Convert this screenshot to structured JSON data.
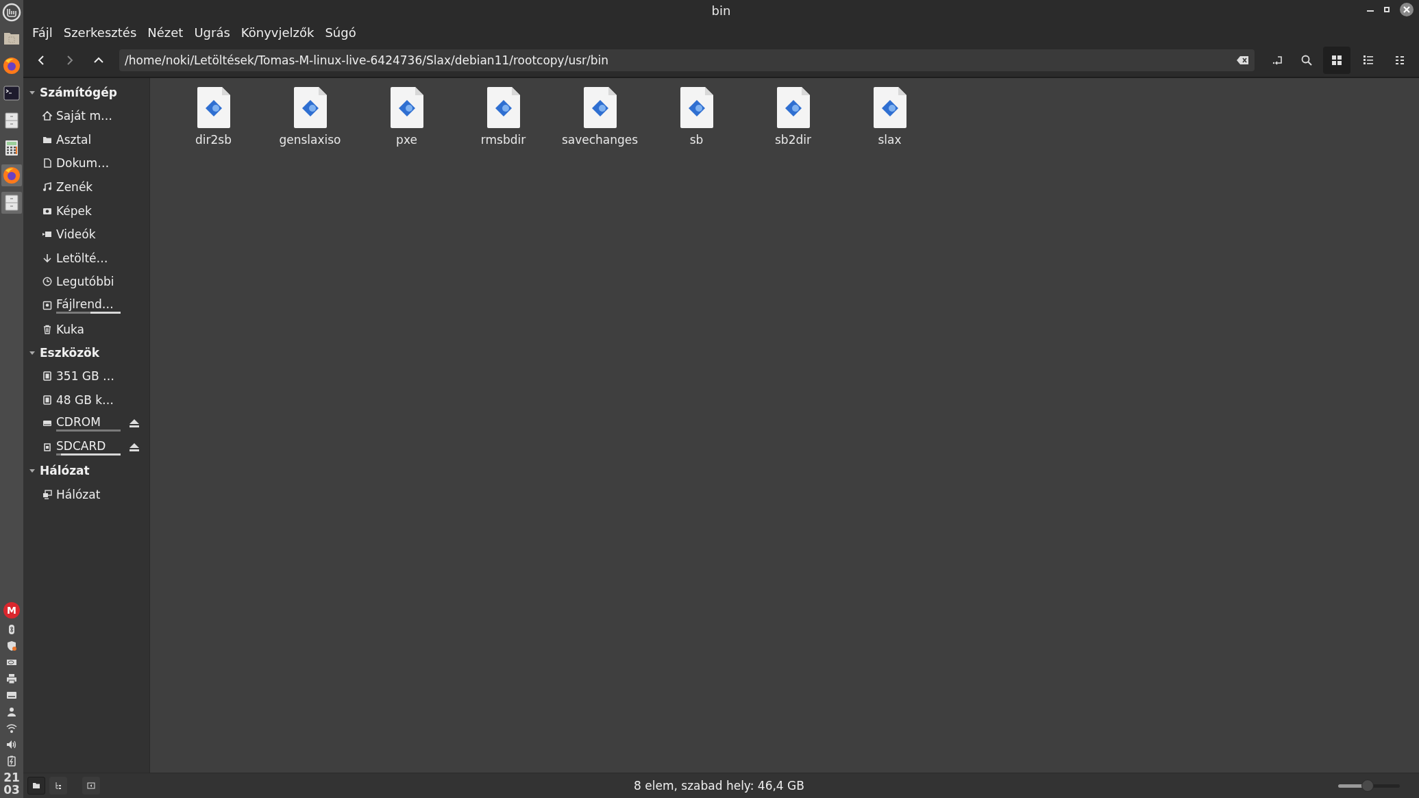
{
  "window": {
    "title": "bin"
  },
  "taskbar": {
    "apps": [
      {
        "kind": "folder",
        "active": false
      },
      {
        "kind": "firefox",
        "active": false
      },
      {
        "kind": "terminal",
        "active": false
      },
      {
        "kind": "cabinet",
        "active": false
      },
      {
        "kind": "calculator",
        "active": false
      },
      {
        "kind": "firefox",
        "active": true
      },
      {
        "kind": "cabinet",
        "active": true
      }
    ],
    "tray": [
      {
        "kind": "mega",
        "label": "M"
      },
      {
        "kind": "bluetooth"
      },
      {
        "kind": "shield"
      },
      {
        "kind": "eye"
      },
      {
        "kind": "printer"
      },
      {
        "kind": "keyboard"
      },
      {
        "kind": "user"
      },
      {
        "kind": "wifi"
      },
      {
        "kind": "volume"
      },
      {
        "kind": "battery"
      }
    ],
    "clock": {
      "hours": "21",
      "minutes": "03"
    }
  },
  "menubar": [
    "Fájl",
    "Szerkesztés",
    "Nézet",
    "Ugrás",
    "Könyvjelzők",
    "Súgó"
  ],
  "toolbar": {
    "path": "/home/noki/Letöltések/Tomas-M-linux-live-6424736/Slax/debian11/rootcopy/usr/bin",
    "views": [
      {
        "kind": "grid",
        "selected": true
      },
      {
        "kind": "list",
        "selected": false
      },
      {
        "kind": "compact",
        "selected": false
      }
    ]
  },
  "sidebar": {
    "sections": [
      {
        "title": "Számítógép",
        "expanded": true,
        "items": [
          {
            "kind": "home",
            "label": "Saját m…"
          },
          {
            "kind": "folder",
            "label": "Asztal"
          },
          {
            "kind": "document",
            "label": "Dokum…"
          },
          {
            "kind": "music",
            "label": "Zenék"
          },
          {
            "kind": "camera",
            "label": "Képek"
          },
          {
            "kind": "video",
            "label": "Videók"
          },
          {
            "kind": "download",
            "label": "Letölté…"
          },
          {
            "kind": "clock",
            "label": "Legutóbbi"
          },
          {
            "kind": "disk",
            "label": "Fájlrend…",
            "level": 0.53
          },
          {
            "kind": "trash",
            "label": "Kuka"
          }
        ]
      },
      {
        "title": "Eszközök",
        "expanded": true,
        "items": [
          {
            "kind": "drive",
            "label": "351 GB …"
          },
          {
            "kind": "drive",
            "label": "48 GB k…"
          },
          {
            "kind": "optical",
            "label": "CDROM",
            "level": 1,
            "eject": true
          },
          {
            "kind": "sdcard",
            "label": "SDCARD",
            "level": 0.07,
            "eject": true
          }
        ]
      },
      {
        "title": "Hálózat",
        "expanded": true,
        "items": [
          {
            "kind": "network",
            "label": "Hálózat"
          }
        ]
      }
    ]
  },
  "files": [
    "dir2sb",
    "genslaxiso",
    "pxe",
    "rmsbdir",
    "savechanges",
    "sb",
    "sb2dir",
    "slax"
  ],
  "status_bar": {
    "buttons": [
      {
        "kind": "places",
        "selected": true
      },
      {
        "kind": "tree",
        "selected": false
      },
      {
        "kind": "toggle",
        "selected": false
      }
    ],
    "text": "8 elem, szabad hely: 46,4 GB",
    "zoom": {
      "level": 0.47
    }
  }
}
